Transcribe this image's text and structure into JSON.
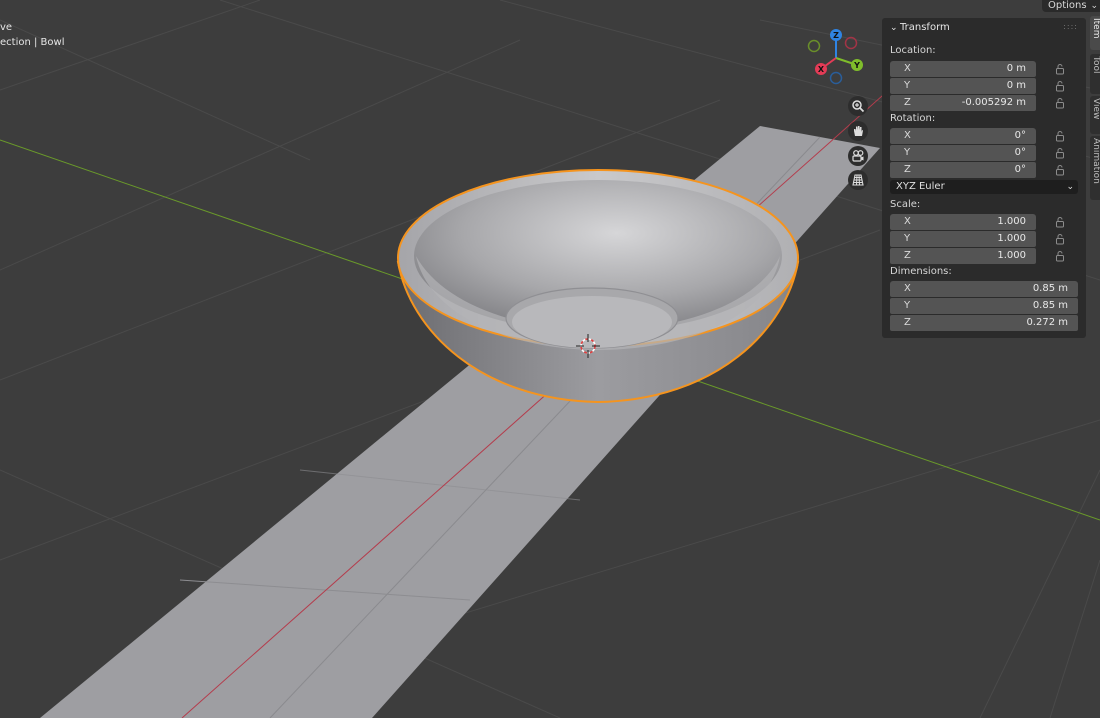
{
  "header": {
    "mode_partial": "ve",
    "collection_partial": "ection | Bowl",
    "options_label": "Options"
  },
  "navigation": {
    "axes": {
      "x": "X",
      "y": "Y",
      "z": "Z"
    },
    "colors": {
      "x": "#e33b56",
      "y": "#7fbd2b",
      "z": "#2f84e3"
    },
    "tools": [
      "zoom-icon",
      "pan-hand-icon",
      "camera-view-icon",
      "ortho-grid-icon"
    ]
  },
  "transform": {
    "title": "Transform",
    "location": {
      "label": "Location:",
      "x": "0 m",
      "y": "0 m",
      "z": "-0.005292 m"
    },
    "rotation": {
      "label": "Rotation:",
      "x": "0°",
      "y": "0°",
      "z": "0°"
    },
    "rotation_mode": "XYZ Euler",
    "scale": {
      "label": "Scale:",
      "x": "1.000",
      "y": "1.000",
      "z": "1.000"
    },
    "dimensions": {
      "label": "Dimensions:",
      "x": "0.85 m",
      "y": "0.85 m",
      "z": "0.272 m"
    },
    "axis_labels": {
      "x": "X",
      "y": "Y",
      "z": "Z"
    }
  },
  "tabs": [
    "Item",
    "Tool",
    "View",
    "Animation"
  ],
  "colors": {
    "selection_outline": "#f5941e",
    "background": "#3d3d3d",
    "panel": "#2b2b2b"
  }
}
